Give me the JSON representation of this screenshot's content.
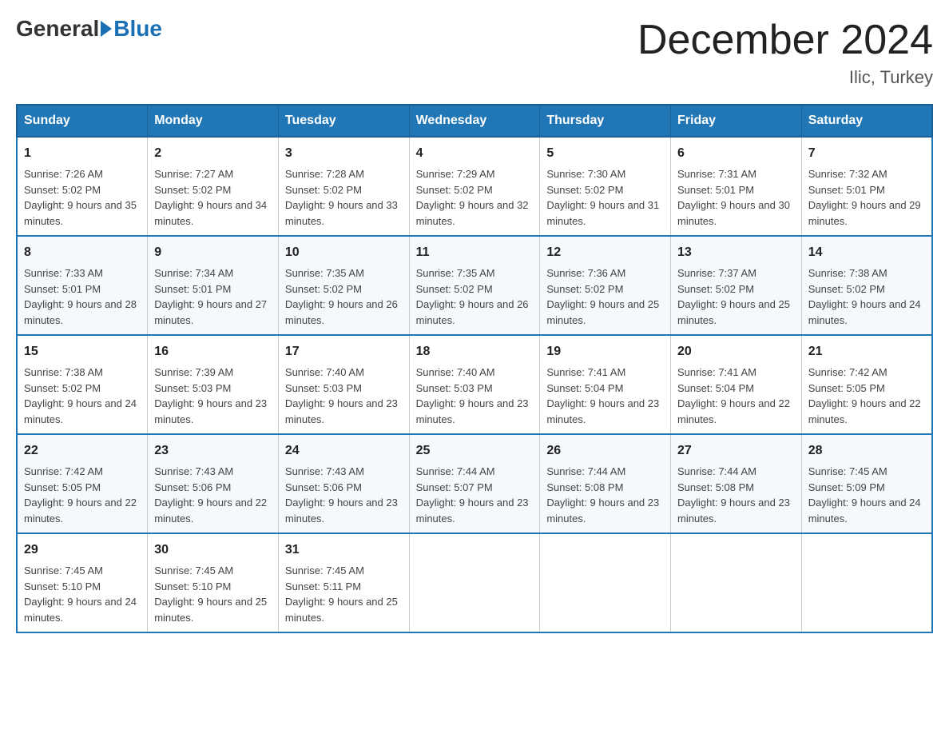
{
  "header": {
    "logo_general": "General",
    "logo_blue": "Blue",
    "month_title": "December 2024",
    "location": "Ilic, Turkey"
  },
  "weekdays": [
    "Sunday",
    "Monday",
    "Tuesday",
    "Wednesday",
    "Thursday",
    "Friday",
    "Saturday"
  ],
  "weeks": [
    [
      {
        "day": "1",
        "sunrise": "7:26 AM",
        "sunset": "5:02 PM",
        "daylight": "9 hours and 35 minutes."
      },
      {
        "day": "2",
        "sunrise": "7:27 AM",
        "sunset": "5:02 PM",
        "daylight": "9 hours and 34 minutes."
      },
      {
        "day": "3",
        "sunrise": "7:28 AM",
        "sunset": "5:02 PM",
        "daylight": "9 hours and 33 minutes."
      },
      {
        "day": "4",
        "sunrise": "7:29 AM",
        "sunset": "5:02 PM",
        "daylight": "9 hours and 32 minutes."
      },
      {
        "day": "5",
        "sunrise": "7:30 AM",
        "sunset": "5:02 PM",
        "daylight": "9 hours and 31 minutes."
      },
      {
        "day": "6",
        "sunrise": "7:31 AM",
        "sunset": "5:01 PM",
        "daylight": "9 hours and 30 minutes."
      },
      {
        "day": "7",
        "sunrise": "7:32 AM",
        "sunset": "5:01 PM",
        "daylight": "9 hours and 29 minutes."
      }
    ],
    [
      {
        "day": "8",
        "sunrise": "7:33 AM",
        "sunset": "5:01 PM",
        "daylight": "9 hours and 28 minutes."
      },
      {
        "day": "9",
        "sunrise": "7:34 AM",
        "sunset": "5:01 PM",
        "daylight": "9 hours and 27 minutes."
      },
      {
        "day": "10",
        "sunrise": "7:35 AM",
        "sunset": "5:02 PM",
        "daylight": "9 hours and 26 minutes."
      },
      {
        "day": "11",
        "sunrise": "7:35 AM",
        "sunset": "5:02 PM",
        "daylight": "9 hours and 26 minutes."
      },
      {
        "day": "12",
        "sunrise": "7:36 AM",
        "sunset": "5:02 PM",
        "daylight": "9 hours and 25 minutes."
      },
      {
        "day": "13",
        "sunrise": "7:37 AM",
        "sunset": "5:02 PM",
        "daylight": "9 hours and 25 minutes."
      },
      {
        "day": "14",
        "sunrise": "7:38 AM",
        "sunset": "5:02 PM",
        "daylight": "9 hours and 24 minutes."
      }
    ],
    [
      {
        "day": "15",
        "sunrise": "7:38 AM",
        "sunset": "5:02 PM",
        "daylight": "9 hours and 24 minutes."
      },
      {
        "day": "16",
        "sunrise": "7:39 AM",
        "sunset": "5:03 PM",
        "daylight": "9 hours and 23 minutes."
      },
      {
        "day": "17",
        "sunrise": "7:40 AM",
        "sunset": "5:03 PM",
        "daylight": "9 hours and 23 minutes."
      },
      {
        "day": "18",
        "sunrise": "7:40 AM",
        "sunset": "5:03 PM",
        "daylight": "9 hours and 23 minutes."
      },
      {
        "day": "19",
        "sunrise": "7:41 AM",
        "sunset": "5:04 PM",
        "daylight": "9 hours and 23 minutes."
      },
      {
        "day": "20",
        "sunrise": "7:41 AM",
        "sunset": "5:04 PM",
        "daylight": "9 hours and 22 minutes."
      },
      {
        "day": "21",
        "sunrise": "7:42 AM",
        "sunset": "5:05 PM",
        "daylight": "9 hours and 22 minutes."
      }
    ],
    [
      {
        "day": "22",
        "sunrise": "7:42 AM",
        "sunset": "5:05 PM",
        "daylight": "9 hours and 22 minutes."
      },
      {
        "day": "23",
        "sunrise": "7:43 AM",
        "sunset": "5:06 PM",
        "daylight": "9 hours and 22 minutes."
      },
      {
        "day": "24",
        "sunrise": "7:43 AM",
        "sunset": "5:06 PM",
        "daylight": "9 hours and 23 minutes."
      },
      {
        "day": "25",
        "sunrise": "7:44 AM",
        "sunset": "5:07 PM",
        "daylight": "9 hours and 23 minutes."
      },
      {
        "day": "26",
        "sunrise": "7:44 AM",
        "sunset": "5:08 PM",
        "daylight": "9 hours and 23 minutes."
      },
      {
        "day": "27",
        "sunrise": "7:44 AM",
        "sunset": "5:08 PM",
        "daylight": "9 hours and 23 minutes."
      },
      {
        "day": "28",
        "sunrise": "7:45 AM",
        "sunset": "5:09 PM",
        "daylight": "9 hours and 24 minutes."
      }
    ],
    [
      {
        "day": "29",
        "sunrise": "7:45 AM",
        "sunset": "5:10 PM",
        "daylight": "9 hours and 24 minutes."
      },
      {
        "day": "30",
        "sunrise": "7:45 AM",
        "sunset": "5:10 PM",
        "daylight": "9 hours and 25 minutes."
      },
      {
        "day": "31",
        "sunrise": "7:45 AM",
        "sunset": "5:11 PM",
        "daylight": "9 hours and 25 minutes."
      },
      null,
      null,
      null,
      null
    ]
  ],
  "labels": {
    "sunrise_prefix": "Sunrise: ",
    "sunset_prefix": "Sunset: ",
    "daylight_prefix": "Daylight: "
  }
}
